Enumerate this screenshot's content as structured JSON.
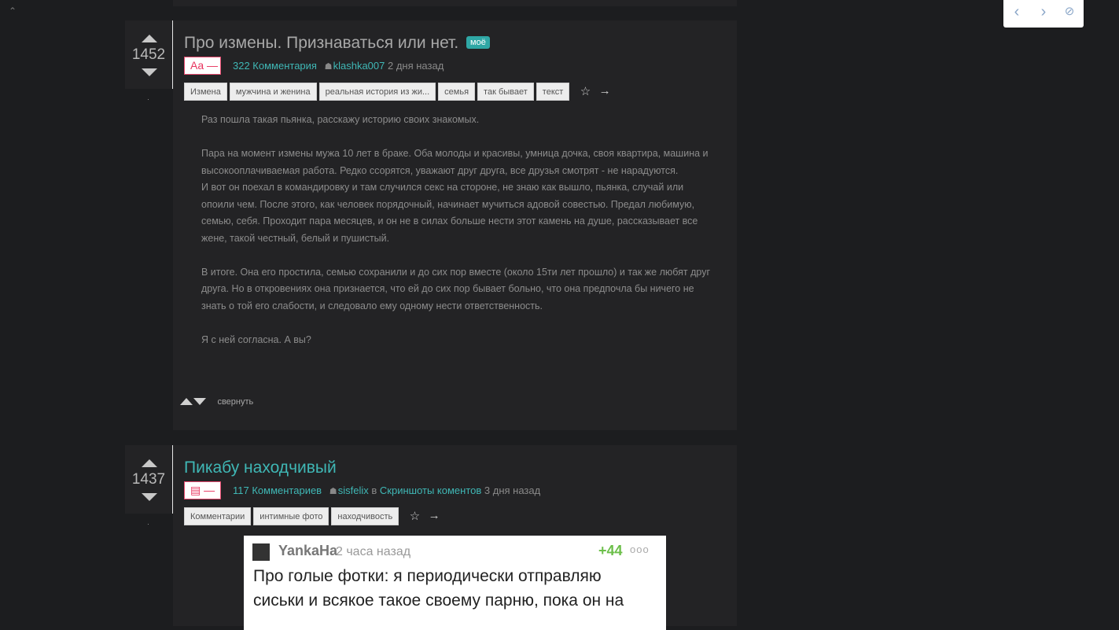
{
  "toolbar": {
    "prev_icon": "‹",
    "next_icon": "›",
    "hide_icon": "⊘"
  },
  "stories": [
    {
      "rating": "1452",
      "title": "Про измены. Признаваться или нет.",
      "badge": "моё",
      "type_label": "Aa —",
      "comments": "322 Комментария",
      "author": "klashka007",
      "time": "2 дня назад",
      "tags": [
        "Измена",
        "мужчина и женина",
        "реальная история из жи...",
        "семья",
        "так бывает",
        "текст"
      ],
      "paragraphs": [
        "Раз пошла такая пьянка, расскажу историю своих знакомых.",
        "Пара на момент измены мужа 10 лет в браке. Оба молоды и красивы, умница дочка, своя квартира, машина и высокооплачиваемая работа. Редко ссорятся, уважают друг друга, все друзья смотрят - не нарадуются.",
        "И вот он поехал в командировку и там случился секс на стороне, не знаю как вышло, пьянка, случай или опоили чем. После этого, как человек порядочный, начинает мучиться адовой совестью. Предал любимую, семью, себя. Проходит пара месяцев, и он не в силах больше нести этот камень на душе, рассказывает все жене, такой честный, белый и пушистый.",
        "В итоге. Она его простила, семью сохранили и до сих пор вместе (около 15ти лет прошло) и так же любят друг друга. Но в откровениях она признается, что ей до сих пор бывает больно, что она предпочла бы ничего не знать о той его слабости, и следовало ему одному нести ответственность.",
        "Я с ней согласна. А вы?"
      ],
      "collapse_label": "свернуть"
    },
    {
      "rating": "1437",
      "title": "Пикабу находчивый",
      "type_label": "▤ —",
      "comments": "117 Комментариев",
      "author": "sisfelix",
      "in_word": "в",
      "community": "Скриншоты коментов",
      "time": "3 дня назад",
      "tags": [
        "Комментарии",
        "интимные фото",
        "находчивость"
      ],
      "screenshot": {
        "user": "YankaHa",
        "time": "2 часа назад",
        "score": "+44",
        "dots": "ooo",
        "text": "Про голые фотки: я периодически отправляю сиськи и всякое такое своему парню, пока он на"
      }
    }
  ]
}
